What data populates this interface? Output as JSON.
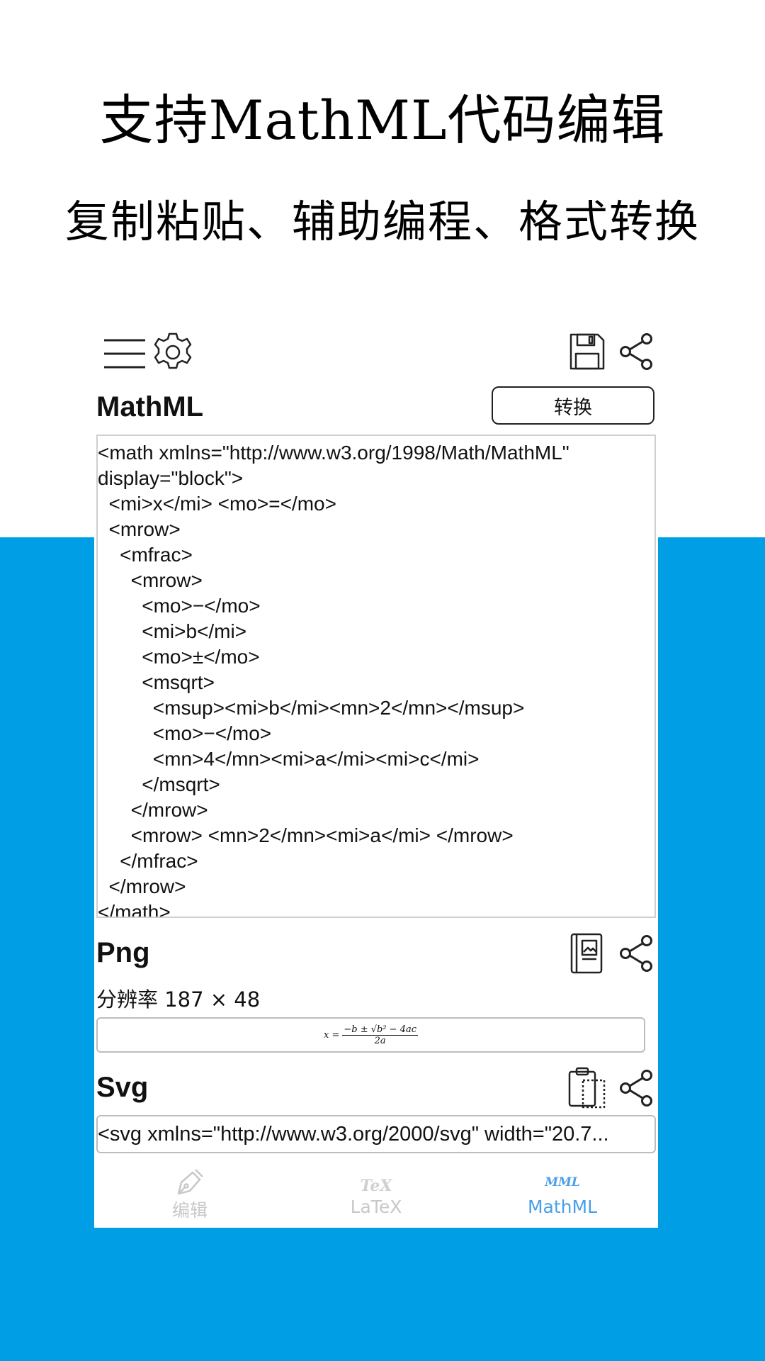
{
  "promo": {
    "headline": "支持MathML代码编辑",
    "subheadline": "复制粘贴、辅助编程、格式转换"
  },
  "toolbar": {
    "icons": [
      "menu-icon",
      "gear-icon",
      "save-icon",
      "share-icon"
    ]
  },
  "mathml_section": {
    "title": "MathML",
    "convert_label": "转换",
    "code_lines": [
      "<math xmlns=\"http://www.w3.org/1998/Math/MathML\"",
      "display=\"block\">",
      "  <mi>x</mi> <mo>=</mo>",
      "  <mrow>",
      "    <mfrac>",
      "      <mrow>",
      "        <mo>−</mo>",
      "        <mi>b</mi>",
      "        <mo>±</mo>",
      "        <msqrt>",
      "          <msup><mi>b</mi><mn>2</mn></msup>",
      "          <mo>−</mo>",
      "          <mn>4</mn><mi>a</mi><mi>c</mi>",
      "        </msqrt>",
      "      </mrow>",
      "      <mrow> <mn>2</mn><mi>a</mi> </mrow>",
      "    </mfrac>",
      "  </mrow>",
      "</math>"
    ]
  },
  "png_section": {
    "title": "Png",
    "resolution_text": "分辨率  187 × 48",
    "formula": {
      "lhs": "x =",
      "numerator": "−b ± √b² − 4ac",
      "denominator": "2a"
    }
  },
  "svg_section": {
    "title": "Svg",
    "code_preview": "<svg xmlns=\"http://www.w3.org/2000/svg\" width=\"20.7..."
  },
  "bottom_nav": {
    "items": [
      {
        "label": "编辑",
        "icon": "pen-icon",
        "active": false
      },
      {
        "label": "LaTeX",
        "icon_text": "TeX",
        "active": false
      },
      {
        "label": "MathML",
        "icon_text": "MML",
        "active": true
      }
    ]
  },
  "colors": {
    "background_band": "#009ee5",
    "nav_active": "#4a9fe8",
    "nav_inactive": "#c8c8c8"
  }
}
